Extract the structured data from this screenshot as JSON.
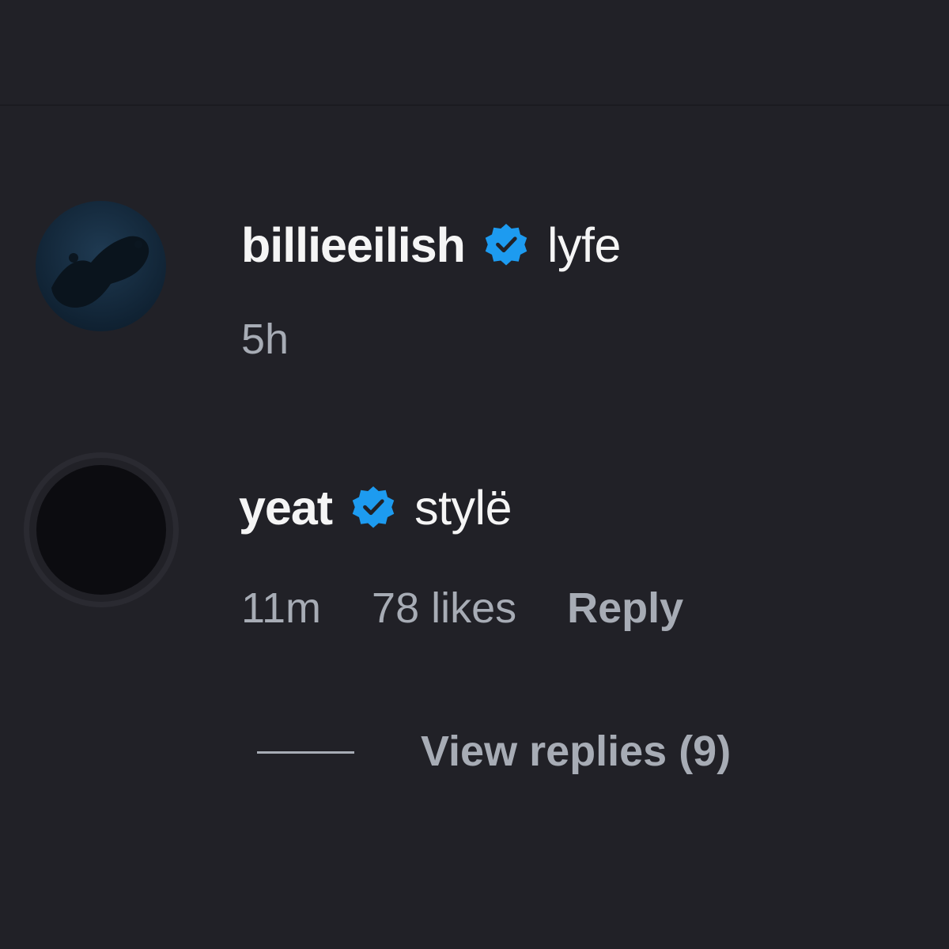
{
  "comments": [
    {
      "username": "billieeilish",
      "verified": true,
      "text": "lyfe",
      "time": "5h",
      "avatar_icon": "dark-underwater-photo-avatar"
    },
    {
      "username": "yeat",
      "verified": true,
      "text": "stylë",
      "time": "11m",
      "likes": "78 likes",
      "reply_label": "Reply",
      "avatar_icon": "dark-circle-avatar-with-story-ring"
    }
  ],
  "view_replies_label": "View replies (9)",
  "colors": {
    "background": "#212127",
    "primary_text": "#f5f5f5",
    "secondary_text": "#a7acb5",
    "verified_badge": "#1d9bf0"
  }
}
